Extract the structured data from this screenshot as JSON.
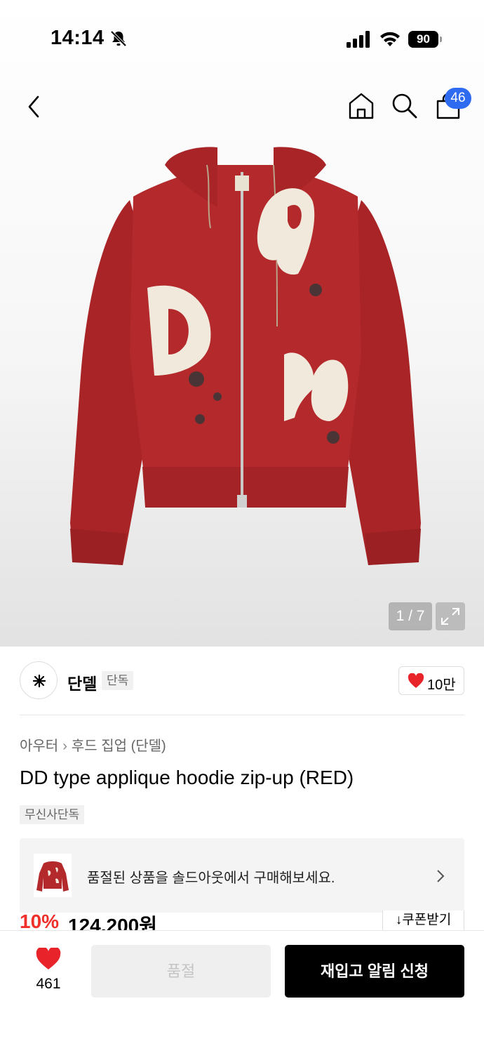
{
  "status_bar": {
    "time": "14:14",
    "battery": "90"
  },
  "nav": {
    "cart_count": "46"
  },
  "gallery": {
    "counter": "1 / 7"
  },
  "brand": {
    "name": "단델",
    "tag": "단독",
    "likes": "10만"
  },
  "breadcrumb": {
    "category": "아우터",
    "subcategory": "후드 집업 (단델)"
  },
  "product": {
    "title": "DD type applique hoodie zip-up (RED)",
    "exclusive_tag": "무신사단독"
  },
  "soldout_banner": {
    "text": "품절된 상품을 솔드아웃에서 구매해보세요."
  },
  "pricing": {
    "discount": "10%",
    "price": "124,200원",
    "coupon_label": "쿠폰받기"
  },
  "bottom_bar": {
    "like_count": "461",
    "soldout_label": "품절",
    "restock_label": "재입고 알림 신청"
  },
  "colors": {
    "accent_red": "#f0302a",
    "badge_blue": "#2f6bf0",
    "hoodie_red": "#b3292c"
  }
}
